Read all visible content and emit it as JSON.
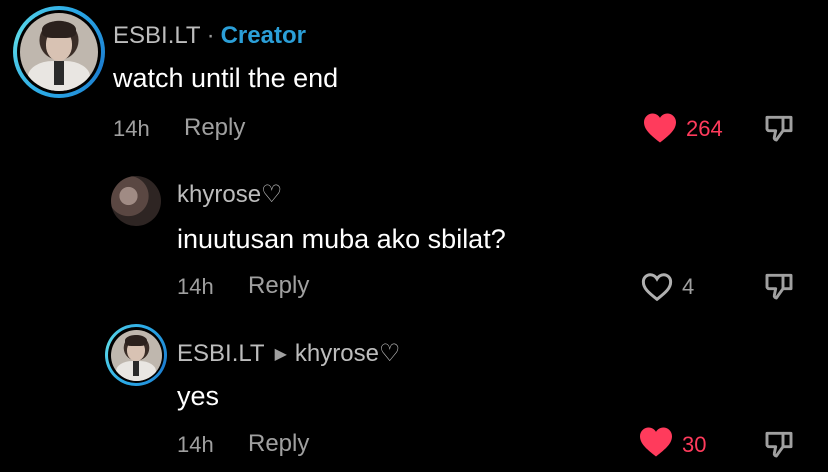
{
  "colors": {
    "accent": "#2b9fd8",
    "like": "#ff3b5c",
    "muted": "#a0a0a0"
  },
  "comments": [
    {
      "author": "ESBI.LT",
      "separator": "·",
      "badge": "Creator",
      "text": "watch until the end",
      "time": "14h",
      "reply": "Reply",
      "likes": "264",
      "liked": true
    },
    {
      "author": "khyrose♡",
      "text": "inuutusan muba ako sbilat?",
      "time": "14h",
      "reply": "Reply",
      "likes": "4",
      "liked": false
    },
    {
      "author": "ESBI.LT",
      "reply_to": "khyrose♡",
      "text": "yes",
      "time": "14h",
      "reply": "Reply",
      "likes": "30",
      "liked": true
    }
  ]
}
